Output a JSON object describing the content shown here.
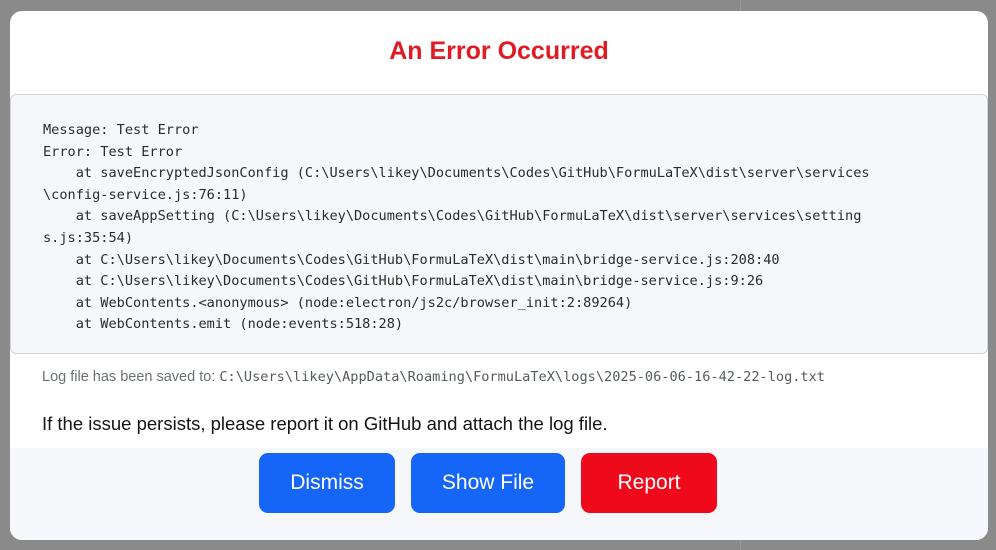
{
  "dialog": {
    "title": "An Error Occurred",
    "stack_trace": "Message: Test Error\nError: Test Error\n    at saveEncryptedJsonConfig (C:\\Users\\likey\\Documents\\Codes\\GitHub\\FormuLaTeX\\dist\\server\\services\n\\config-service.js:76:11)\n    at saveAppSetting (C:\\Users\\likey\\Documents\\Codes\\GitHub\\FormuLaTeX\\dist\\server\\services\\setting\ns.js:35:54)\n    at C:\\Users\\likey\\Documents\\Codes\\GitHub\\FormuLaTeX\\dist\\main\\bridge-service.js:208:40\n    at C:\\Users\\likey\\Documents\\Codes\\GitHub\\FormuLaTeX\\dist\\main\\bridge-service.js:9:26\n    at WebContents.<anonymous> (node:electron/js2c/browser_init:2:89264)\n    at WebContents.emit (node:events:518:28)",
    "log_label": "Log file has been saved to: ",
    "log_path": "C:\\Users\\likey\\AppData\\Roaming\\FormuLaTeX\\logs\\2025-06-06-16-42-22-log.txt",
    "hint": "If the issue persists, please report it on GitHub and attach the log file.",
    "buttons": {
      "dismiss": "Dismiss",
      "show_file": "Show File",
      "report": "Report"
    }
  },
  "colors": {
    "title": "#e01b24",
    "primary": "#1565f7",
    "danger": "#ee0a1b"
  }
}
